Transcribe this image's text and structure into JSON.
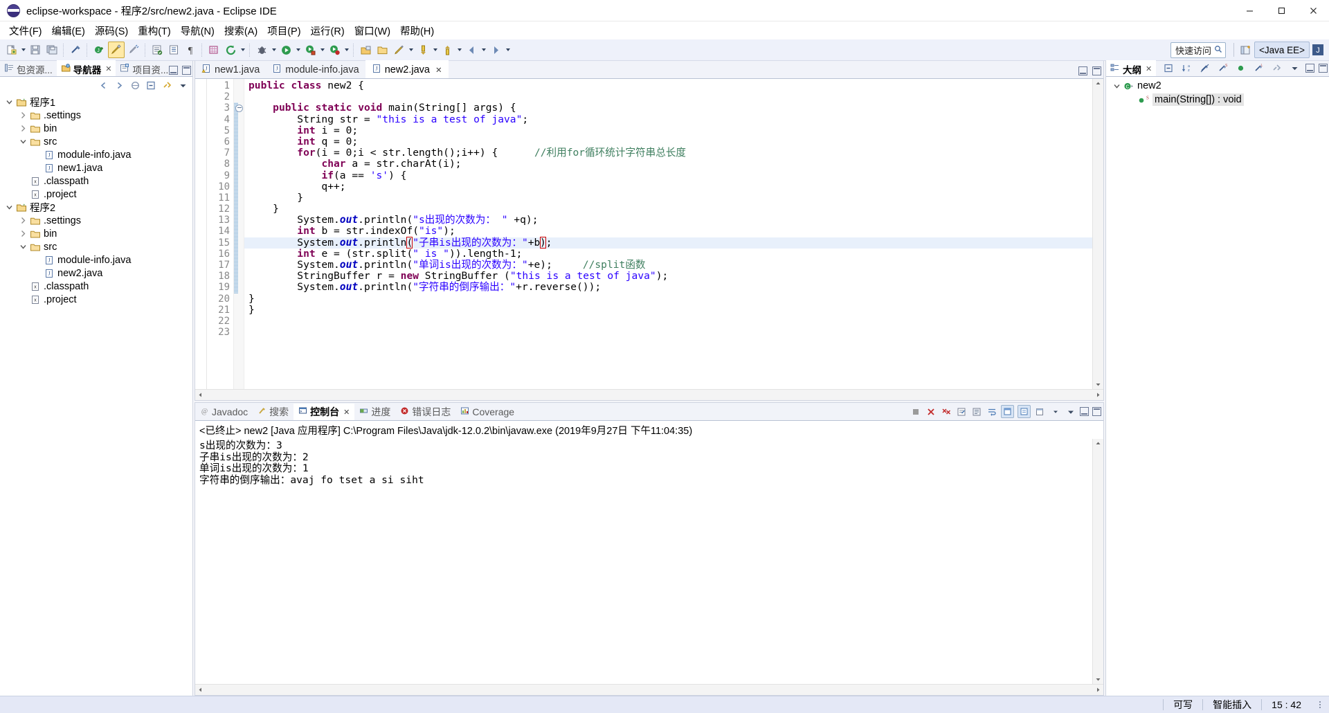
{
  "window": {
    "title": "eclipse-workspace - 程序2/src/new2.java - Eclipse IDE",
    "logo_icon": "eclipse-logo-icon",
    "minimize_label": "minimize",
    "maximize_label": "maximize",
    "close_label": "close"
  },
  "menu": {
    "items": [
      {
        "label": "文件(F)"
      },
      {
        "label": "编辑(E)"
      },
      {
        "label": "源码(S)"
      },
      {
        "label": "重构(T)"
      },
      {
        "label": "导航(N)"
      },
      {
        "label": "搜索(A)"
      },
      {
        "label": "项目(P)"
      },
      {
        "label": "运行(R)"
      },
      {
        "label": "窗口(W)"
      },
      {
        "label": "帮助(H)"
      }
    ]
  },
  "toolbar": {
    "quick_access_value": "快速访问",
    "quick_access_icon": "magnifier-icon",
    "perspective_java_ee": "<Java EE>",
    "perspective_java_icon": "java-perspective-icon",
    "icons": [
      "new-wizard-icon",
      "save-icon",
      "save-all-icon",
      "print-icon",
      "link-icon",
      "new-java-project-icon",
      "highlight-icon",
      "quick-fix-icon",
      "build-icon",
      "open-type-icon",
      "paragraph-icon",
      "search-icon",
      "refresh-icon",
      "debug-icon",
      "run-icon",
      "external-tools-icon",
      "coverage-icon",
      "open-perspective-icon",
      "new-folder-icon",
      "pencil-icon",
      "previous-annotation-icon",
      "next-annotation-icon",
      "back-icon"
    ]
  },
  "navigator": {
    "tabs": [
      {
        "label": "包资源...",
        "icon": "package-explorer-icon",
        "active": false,
        "closable": false
      },
      {
        "label": "导航器",
        "icon": "navigator-icon",
        "active": true,
        "closable": true
      },
      {
        "label": "项目资...",
        "icon": "project-explorer-icon",
        "active": false,
        "closable": false
      }
    ],
    "toolbar_icons": [
      "back-arrow-icon",
      "forward-arrow-icon",
      "home-icon",
      "collapse-all-icon",
      "link-editor-icon",
      "view-menu-icon"
    ],
    "minimize_icon": "minimize-view-icon",
    "maximize_icon": "maximize-view-icon",
    "tree": [
      {
        "label": "程序1",
        "indent": 0,
        "twisty": "open",
        "icon": "project-icon"
      },
      {
        "label": ".settings",
        "indent": 1,
        "twisty": "closed",
        "icon": "folder-icon"
      },
      {
        "label": "bin",
        "indent": 1,
        "twisty": "closed",
        "icon": "folder-icon"
      },
      {
        "label": "src",
        "indent": 1,
        "twisty": "open",
        "icon": "folder-icon"
      },
      {
        "label": "module-info.java",
        "indent": 2,
        "twisty": "none",
        "icon": "java-file-icon"
      },
      {
        "label": "new1.java",
        "indent": 2,
        "twisty": "none",
        "icon": "java-file-icon"
      },
      {
        "label": ".classpath",
        "indent": 1,
        "twisty": "none",
        "icon": "xml-file-icon"
      },
      {
        "label": ".project",
        "indent": 1,
        "twisty": "none",
        "icon": "xml-file-icon"
      },
      {
        "label": "程序2",
        "indent": 0,
        "twisty": "open",
        "icon": "project-icon"
      },
      {
        "label": ".settings",
        "indent": 1,
        "twisty": "closed",
        "icon": "folder-icon"
      },
      {
        "label": "bin",
        "indent": 1,
        "twisty": "closed",
        "icon": "folder-icon"
      },
      {
        "label": "src",
        "indent": 1,
        "twisty": "open",
        "icon": "folder-icon"
      },
      {
        "label": "module-info.java",
        "indent": 2,
        "twisty": "none",
        "icon": "java-file-icon"
      },
      {
        "label": "new2.java",
        "indent": 2,
        "twisty": "none",
        "icon": "java-file-icon"
      },
      {
        "label": ".classpath",
        "indent": 1,
        "twisty": "none",
        "icon": "xml-file-icon"
      },
      {
        "label": ".project",
        "indent": 1,
        "twisty": "none",
        "icon": "xml-file-icon"
      }
    ]
  },
  "editor": {
    "tabs": [
      {
        "label": "new1.java",
        "icon": "java-file-warning-icon",
        "active": false,
        "closable": false
      },
      {
        "label": "module-info.java",
        "icon": "java-file-icon",
        "active": false,
        "closable": false
      },
      {
        "label": "new2.java",
        "icon": "java-file-icon",
        "active": true,
        "closable": true
      }
    ],
    "minimize_icon": "minimize-editor-icon",
    "maximize_icon": "maximize-editor-icon",
    "current_line": 15,
    "line_numbers": [
      1,
      2,
      3,
      4,
      5,
      6,
      7,
      8,
      9,
      10,
      11,
      12,
      13,
      14,
      15,
      16,
      17,
      18,
      19,
      20,
      21,
      22,
      23
    ],
    "lines": [
      {
        "n": 1,
        "indent": 0,
        "tokens": [
          {
            "t": "public",
            "c": "kw"
          },
          {
            "t": " ",
            "c": ""
          },
          {
            "t": "class",
            "c": "kw"
          },
          {
            "t": " new2 {",
            "c": ""
          }
        ]
      },
      {
        "n": 2,
        "indent": 0,
        "tokens": []
      },
      {
        "n": 3,
        "indent": 1,
        "fold": true,
        "tokens": [
          {
            "t": "public",
            "c": "kw"
          },
          {
            "t": " ",
            "c": ""
          },
          {
            "t": "static",
            "c": "kw"
          },
          {
            "t": " ",
            "c": ""
          },
          {
            "t": "void",
            "c": "kw"
          },
          {
            "t": " main(String[] args) {",
            "c": ""
          }
        ]
      },
      {
        "n": 4,
        "indent": 2,
        "tokens": [
          {
            "t": "String str = ",
            "c": ""
          },
          {
            "t": "\"this is a test of java\"",
            "c": "str"
          },
          {
            "t": ";",
            "c": ""
          }
        ]
      },
      {
        "n": 5,
        "indent": 2,
        "tokens": [
          {
            "t": "int",
            "c": "kw"
          },
          {
            "t": " i = 0;",
            "c": ""
          }
        ]
      },
      {
        "n": 6,
        "indent": 2,
        "tokens": [
          {
            "t": "int",
            "c": "kw"
          },
          {
            "t": " q = 0;",
            "c": ""
          }
        ]
      },
      {
        "n": 7,
        "indent": 2,
        "tokens": [
          {
            "t": "for",
            "c": "kw"
          },
          {
            "t": "(i = 0;i < str.length();i++) {      ",
            "c": ""
          },
          {
            "t": "//利用for循环统计字符串总长度",
            "c": "cmt"
          }
        ]
      },
      {
        "n": 8,
        "indent": 3,
        "tokens": [
          {
            "t": "char",
            "c": "kw"
          },
          {
            "t": " a = str.charAt(i);",
            "c": ""
          }
        ]
      },
      {
        "n": 9,
        "indent": 3,
        "tokens": [
          {
            "t": "if",
            "c": "kw"
          },
          {
            "t": "(a == ",
            "c": ""
          },
          {
            "t": "'s'",
            "c": "str"
          },
          {
            "t": ") {",
            "c": ""
          }
        ]
      },
      {
        "n": 10,
        "indent": 3,
        "tokens": [
          {
            "t": "q++;",
            "c": ""
          }
        ]
      },
      {
        "n": 11,
        "indent": 2,
        "tokens": [
          {
            "t": "}",
            "c": ""
          }
        ]
      },
      {
        "n": 12,
        "indent": 1,
        "tokens": [
          {
            "t": "}",
            "c": ""
          }
        ]
      },
      {
        "n": 13,
        "indent": 2,
        "tokens": [
          {
            "t": "System.",
            "c": ""
          },
          {
            "t": "out",
            "c": "fld"
          },
          {
            "t": ".println(",
            "c": ""
          },
          {
            "t": "\"s出现的次数为： \"",
            "c": "str"
          },
          {
            "t": " +q);",
            "c": ""
          }
        ]
      },
      {
        "n": 14,
        "indent": 2,
        "tokens": [
          {
            "t": "int",
            "c": "kw"
          },
          {
            "t": " b = str.indexOf(",
            "c": ""
          },
          {
            "t": "\"is\"",
            "c": "str"
          },
          {
            "t": ");",
            "c": ""
          }
        ]
      },
      {
        "n": 15,
        "indent": 2,
        "current": true,
        "tokens": [
          {
            "t": "System.",
            "c": ""
          },
          {
            "t": "out",
            "c": "fld"
          },
          {
            "t": ".println",
            "c": ""
          },
          {
            "t": "(",
            "c": "brk"
          },
          {
            "t": "\"子串is出现的次数为：\"",
            "c": "str"
          },
          {
            "t": "+b",
            "c": ""
          },
          {
            "t": "caret",
            "c": "caret"
          },
          {
            "t": ")",
            "c": "brk"
          },
          {
            "t": ";",
            "c": ""
          }
        ]
      },
      {
        "n": 16,
        "indent": 2,
        "tokens": [
          {
            "t": "int",
            "c": "kw"
          },
          {
            "t": " e = (str.split(",
            "c": ""
          },
          {
            "t": "\" is \"",
            "c": "str"
          },
          {
            "t": ")).length-1;",
            "c": ""
          }
        ]
      },
      {
        "n": 17,
        "indent": 2,
        "tokens": [
          {
            "t": "System.",
            "c": ""
          },
          {
            "t": "out",
            "c": "fld"
          },
          {
            "t": ".println(",
            "c": ""
          },
          {
            "t": "\"单词is出现的次数为：\"",
            "c": "str"
          },
          {
            "t": "+e);     ",
            "c": ""
          },
          {
            "t": "//split函数",
            "c": "cmt"
          }
        ]
      },
      {
        "n": 18,
        "indent": 2,
        "tokens": [
          {
            "t": "StringBuffer r = ",
            "c": ""
          },
          {
            "t": "new",
            "c": "kw"
          },
          {
            "t": " StringBuffer (",
            "c": ""
          },
          {
            "t": "\"this is a test of java\"",
            "c": "str"
          },
          {
            "t": ");",
            "c": ""
          }
        ]
      },
      {
        "n": 19,
        "indent": 2,
        "tokens": [
          {
            "t": "System.",
            "c": ""
          },
          {
            "t": "out",
            "c": "fld"
          },
          {
            "t": ".println(",
            "c": ""
          },
          {
            "t": "\"字符串的倒序输出：\"",
            "c": "str"
          },
          {
            "t": "+r.reverse());",
            "c": ""
          }
        ]
      },
      {
        "n": 20,
        "indent": 0,
        "tokens": [
          {
            "t": "}",
            "c": ""
          }
        ]
      },
      {
        "n": 21,
        "indent": 0,
        "tokens": [
          {
            "t": "}",
            "c": ""
          }
        ]
      },
      {
        "n": 22,
        "indent": 0,
        "tokens": []
      },
      {
        "n": 23,
        "indent": 0,
        "tokens": []
      }
    ]
  },
  "console": {
    "tabs": [
      {
        "label": "Javadoc",
        "icon": "javadoc-icon",
        "active": false,
        "closable": false
      },
      {
        "label": "搜索",
        "icon": "search-icon",
        "active": false,
        "closable": false
      },
      {
        "label": "控制台",
        "icon": "console-icon",
        "active": true,
        "closable": true
      },
      {
        "label": "进度",
        "icon": "progress-icon",
        "active": false,
        "closable": false
      },
      {
        "label": "错误日志",
        "icon": "error-log-icon",
        "active": false,
        "closable": false
      },
      {
        "label": "Coverage",
        "icon": "coverage-icon",
        "active": false,
        "closable": false
      }
    ],
    "toolbar_icons": [
      "terminate-icon",
      "remove-launch-icon",
      "remove-all-icon",
      "clear-console-icon",
      "scroll-lock-icon",
      "word-wrap-icon",
      "pin-console-icon",
      "display-selected-icon",
      "open-console-icon",
      "view-menu-icon",
      "minimize-icon",
      "maximize-icon"
    ],
    "header": "<已终止> new2 [Java 应用程序] C:\\Program Files\\Java\\jdk-12.0.2\\bin\\javaw.exe  (2019年9月27日 下午11:04:35)",
    "output": [
      "s出现的次数为：3",
      "子串is出现的次数为：2",
      "单词is出现的次数为：1",
      "字符串的倒序输出：avaj fo tset a si siht"
    ]
  },
  "outline": {
    "tab_label": "大纲",
    "tab_icon": "outline-icon",
    "toolbar_icons": [
      "collapse-all-icon",
      "sort-icon",
      "hide-fields-icon",
      "hide-static-icon",
      "hide-nonpublic-icon",
      "hide-local-types-icon",
      "link-icon",
      "view-menu-icon"
    ],
    "minimize_icon": "minimize-view-icon",
    "maximize_icon": "maximize-view-icon",
    "items": [
      {
        "label": "new2",
        "indent": 0,
        "twisty": "open",
        "icon": "java-class-icon",
        "selected": false
      },
      {
        "label": "main(String[]) : void",
        "indent": 1,
        "twisty": "none",
        "icon": "public-method-static-icon",
        "selected": true
      }
    ]
  },
  "statusbar": {
    "writable": "可写",
    "insert_mode": "智能插入",
    "cursor_position": "15 : 42"
  }
}
